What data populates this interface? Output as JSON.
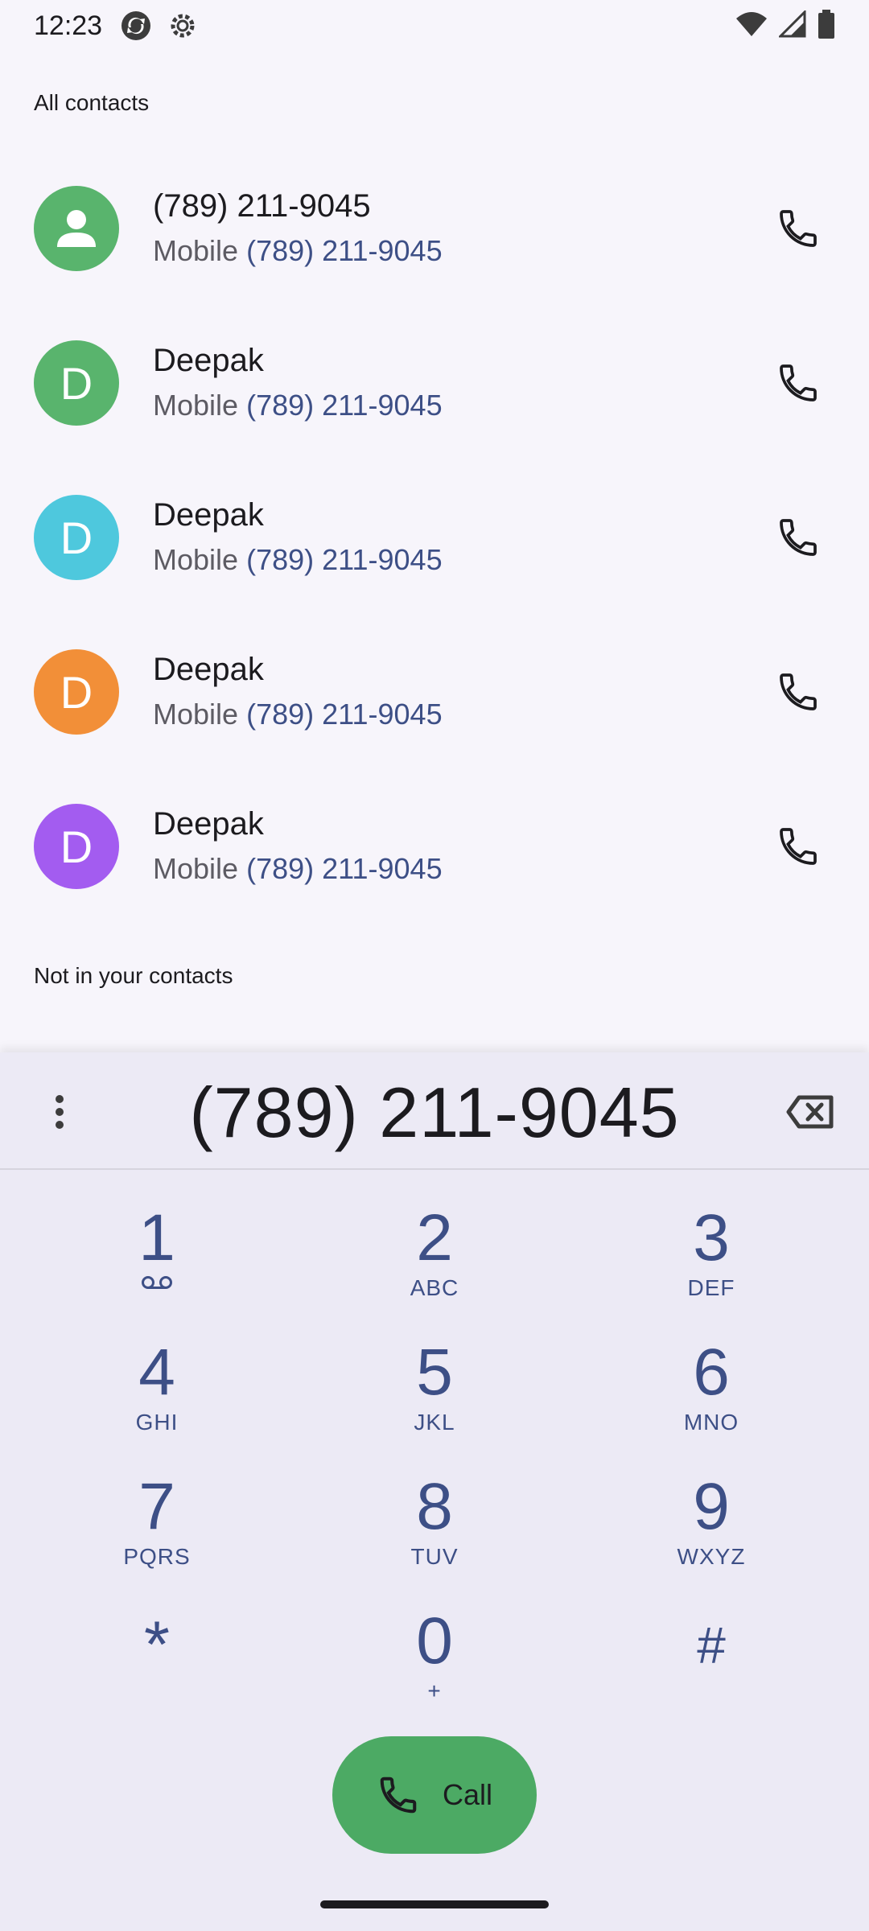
{
  "status_bar": {
    "time": "12:23"
  },
  "sections": {
    "all_contacts": "All contacts",
    "not_in_contacts": "Not in your contacts"
  },
  "contacts": [
    {
      "name": "(789) 211-9045",
      "label": "Mobile",
      "number": "(789) 211-9045",
      "avatar_letter": "",
      "avatar_color": "#59b46d"
    },
    {
      "name": "Deepak",
      "label": "Mobile",
      "number": "(789) 211-9045",
      "avatar_letter": "D",
      "avatar_color": "#59b46d"
    },
    {
      "name": "Deepak",
      "label": "Mobile",
      "number": "(789) 211-9045",
      "avatar_letter": "D",
      "avatar_color": "#4ec8dd"
    },
    {
      "name": "Deepak",
      "label": "Mobile",
      "number": "(789) 211-9045",
      "avatar_letter": "D",
      "avatar_color": "#f28f38"
    },
    {
      "name": "Deepak",
      "label": "Mobile",
      "number": "(789) 211-9045",
      "avatar_letter": "D",
      "avatar_color": "#a35cf0"
    }
  ],
  "dialer": {
    "digits": "(789) 211-9045",
    "keys": [
      {
        "digit": "1",
        "letters": ""
      },
      {
        "digit": "2",
        "letters": "ABC"
      },
      {
        "digit": "3",
        "letters": "DEF"
      },
      {
        "digit": "4",
        "letters": "GHI"
      },
      {
        "digit": "5",
        "letters": "JKL"
      },
      {
        "digit": "6",
        "letters": "MNO"
      },
      {
        "digit": "7",
        "letters": "PQRS"
      },
      {
        "digit": "8",
        "letters": "TUV"
      },
      {
        "digit": "9",
        "letters": "WXYZ"
      },
      {
        "digit": "*",
        "letters": ""
      },
      {
        "digit": "0",
        "letters": "+"
      },
      {
        "digit": "#",
        "letters": ""
      }
    ],
    "call_label": "Call"
  },
  "colors": {
    "accent_blue": "#3d4f86",
    "call_green": "#4caa64"
  }
}
